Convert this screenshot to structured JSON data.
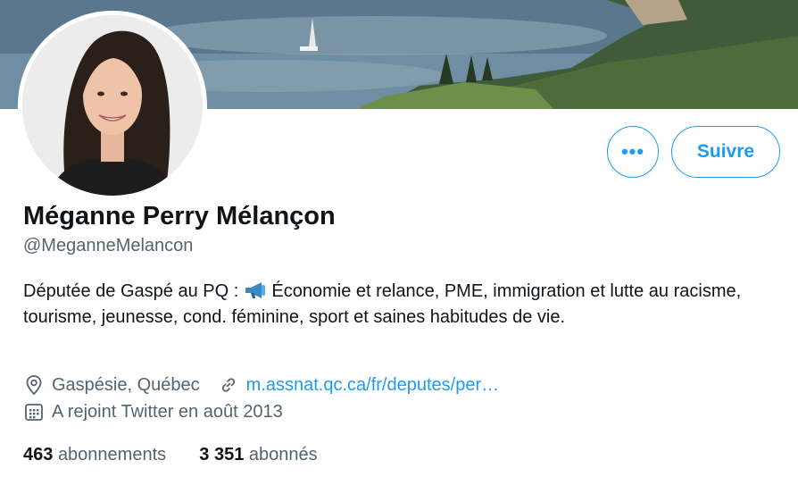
{
  "profile": {
    "name": "Méganne Perry Mélançon",
    "handle": "@MeganneMelancon",
    "bio_part1": "Députée de Gaspé au PQ : ",
    "bio_emoji": "megaphone",
    "bio_part2": " Économie et relance, PME, immigration et lutte au racisme, tourisme, jeunesse, cond. féminine, sport et saines habitudes de vie.",
    "location": "Gaspésie, Québec",
    "website": "m.assnat.qc.ca/fr/deputes/per…",
    "joined": "A rejoint Twitter en août 2013"
  },
  "actions": {
    "more_label": "•••",
    "follow_label": "Suivre"
  },
  "stats": {
    "following_count": "463",
    "following_label": "abonnements",
    "followers_count": "3 351",
    "followers_label": "abonnés"
  },
  "icons": {
    "location": "location-pin-icon",
    "website": "link-icon",
    "joined": "calendar-icon"
  },
  "colors": {
    "accent": "#1d9bf0",
    "secondary_text": "#536471",
    "primary_text": "#0f1419"
  }
}
